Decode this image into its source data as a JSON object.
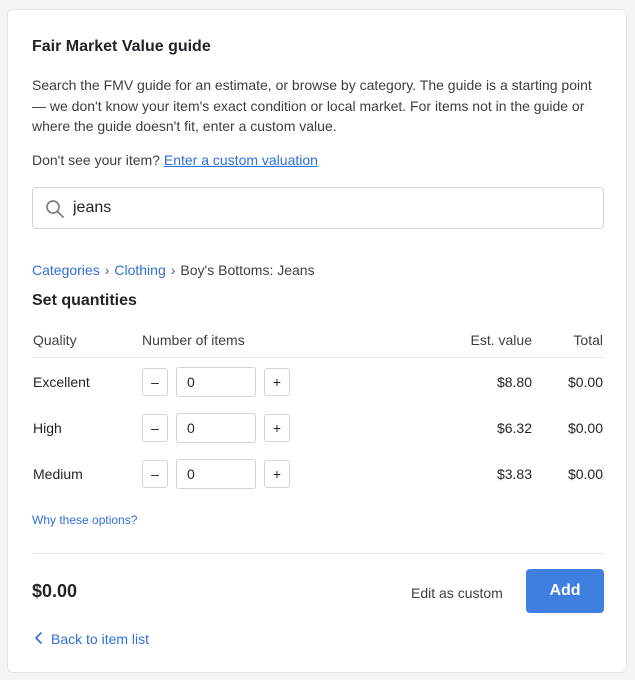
{
  "title": "Fair Market Value guide",
  "description": "Search the FMV guide for an estimate, or browse by category. The guide is a starting point — we don't know your item's exact condition or local market. For items not in the guide or where the guide doesn't fit, enter a custom value.",
  "custom_prompt": {
    "text": "Don't see your item?",
    "link": "Enter a custom valuation"
  },
  "search": {
    "icon": "search-icon",
    "value": "jeans"
  },
  "breadcrumb": {
    "items": [
      "Categories",
      "Clothing",
      "Boy's Bottoms: Jeans"
    ],
    "separator": "›"
  },
  "quantities": {
    "title": "Set quantities",
    "columns": {
      "quality": "Quality",
      "number": "Number of items",
      "est": "Est. value",
      "total": "Total"
    },
    "rows": [
      {
        "quality": "Excellent",
        "qty": "0",
        "est": "$8.80",
        "total": "$0.00"
      },
      {
        "quality": "High",
        "qty": "0",
        "est": "$6.32",
        "total": "$0.00"
      },
      {
        "quality": "Medium",
        "qty": "0",
        "est": "$3.83",
        "total": "$0.00"
      }
    ],
    "minus": "–",
    "plus": "+"
  },
  "why_link": "Why these options?",
  "footer": {
    "total": "$0.00",
    "edit_custom": "Edit as custom",
    "add": "Add"
  },
  "back": {
    "icon": "chevron-left-icon",
    "label": "Back to item list"
  },
  "colors": {
    "accent": "#3f7fe0",
    "link": "#2f6fd6"
  }
}
